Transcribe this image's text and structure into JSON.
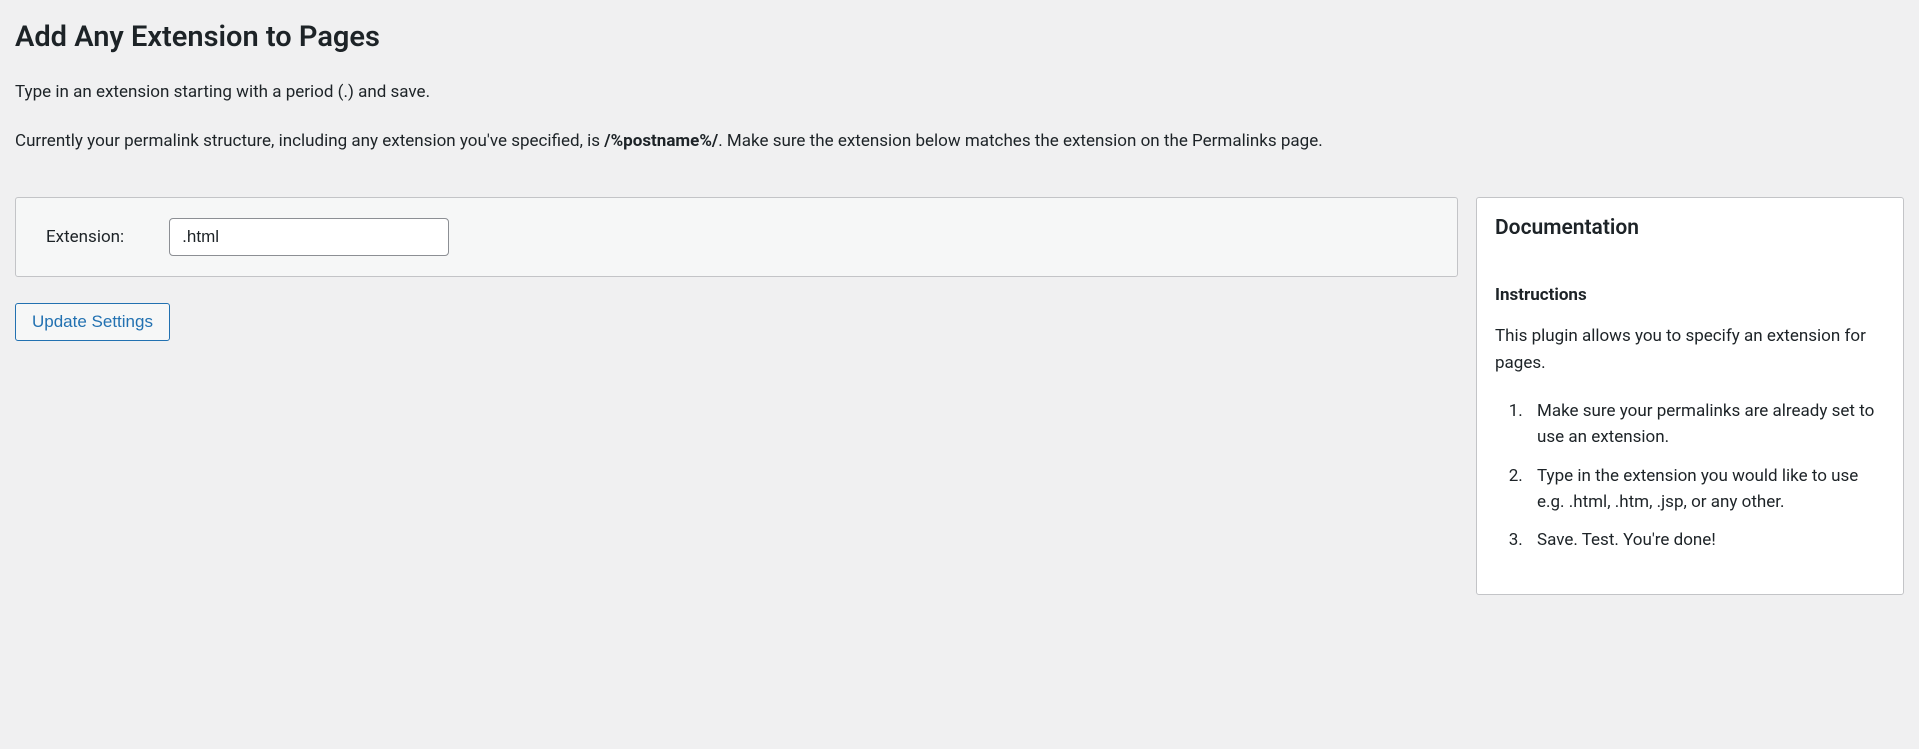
{
  "page": {
    "title": "Add Any Extension to Pages",
    "intro1": "Type in an extension starting with a period (.) and save.",
    "intro2_prefix": "Currently your permalink structure, including any extension you've specified, is ",
    "intro2_strong": "/%postname%/",
    "intro2_suffix": ". Make sure the extension below matches the extension on the Permalinks page."
  },
  "form": {
    "label": "Extension:",
    "value": ".html",
    "submit_label": "Update Settings"
  },
  "documentation": {
    "title": "Documentation",
    "subtitle": "Instructions",
    "description": "This plugin allows you to specify an extension for pages.",
    "steps": [
      "Make sure your permalinks are already set to use an extension.",
      "Type in the extension you would like to use e.g. .html, .htm, .jsp, or any other.",
      "Save. Test. You're done!"
    ]
  }
}
